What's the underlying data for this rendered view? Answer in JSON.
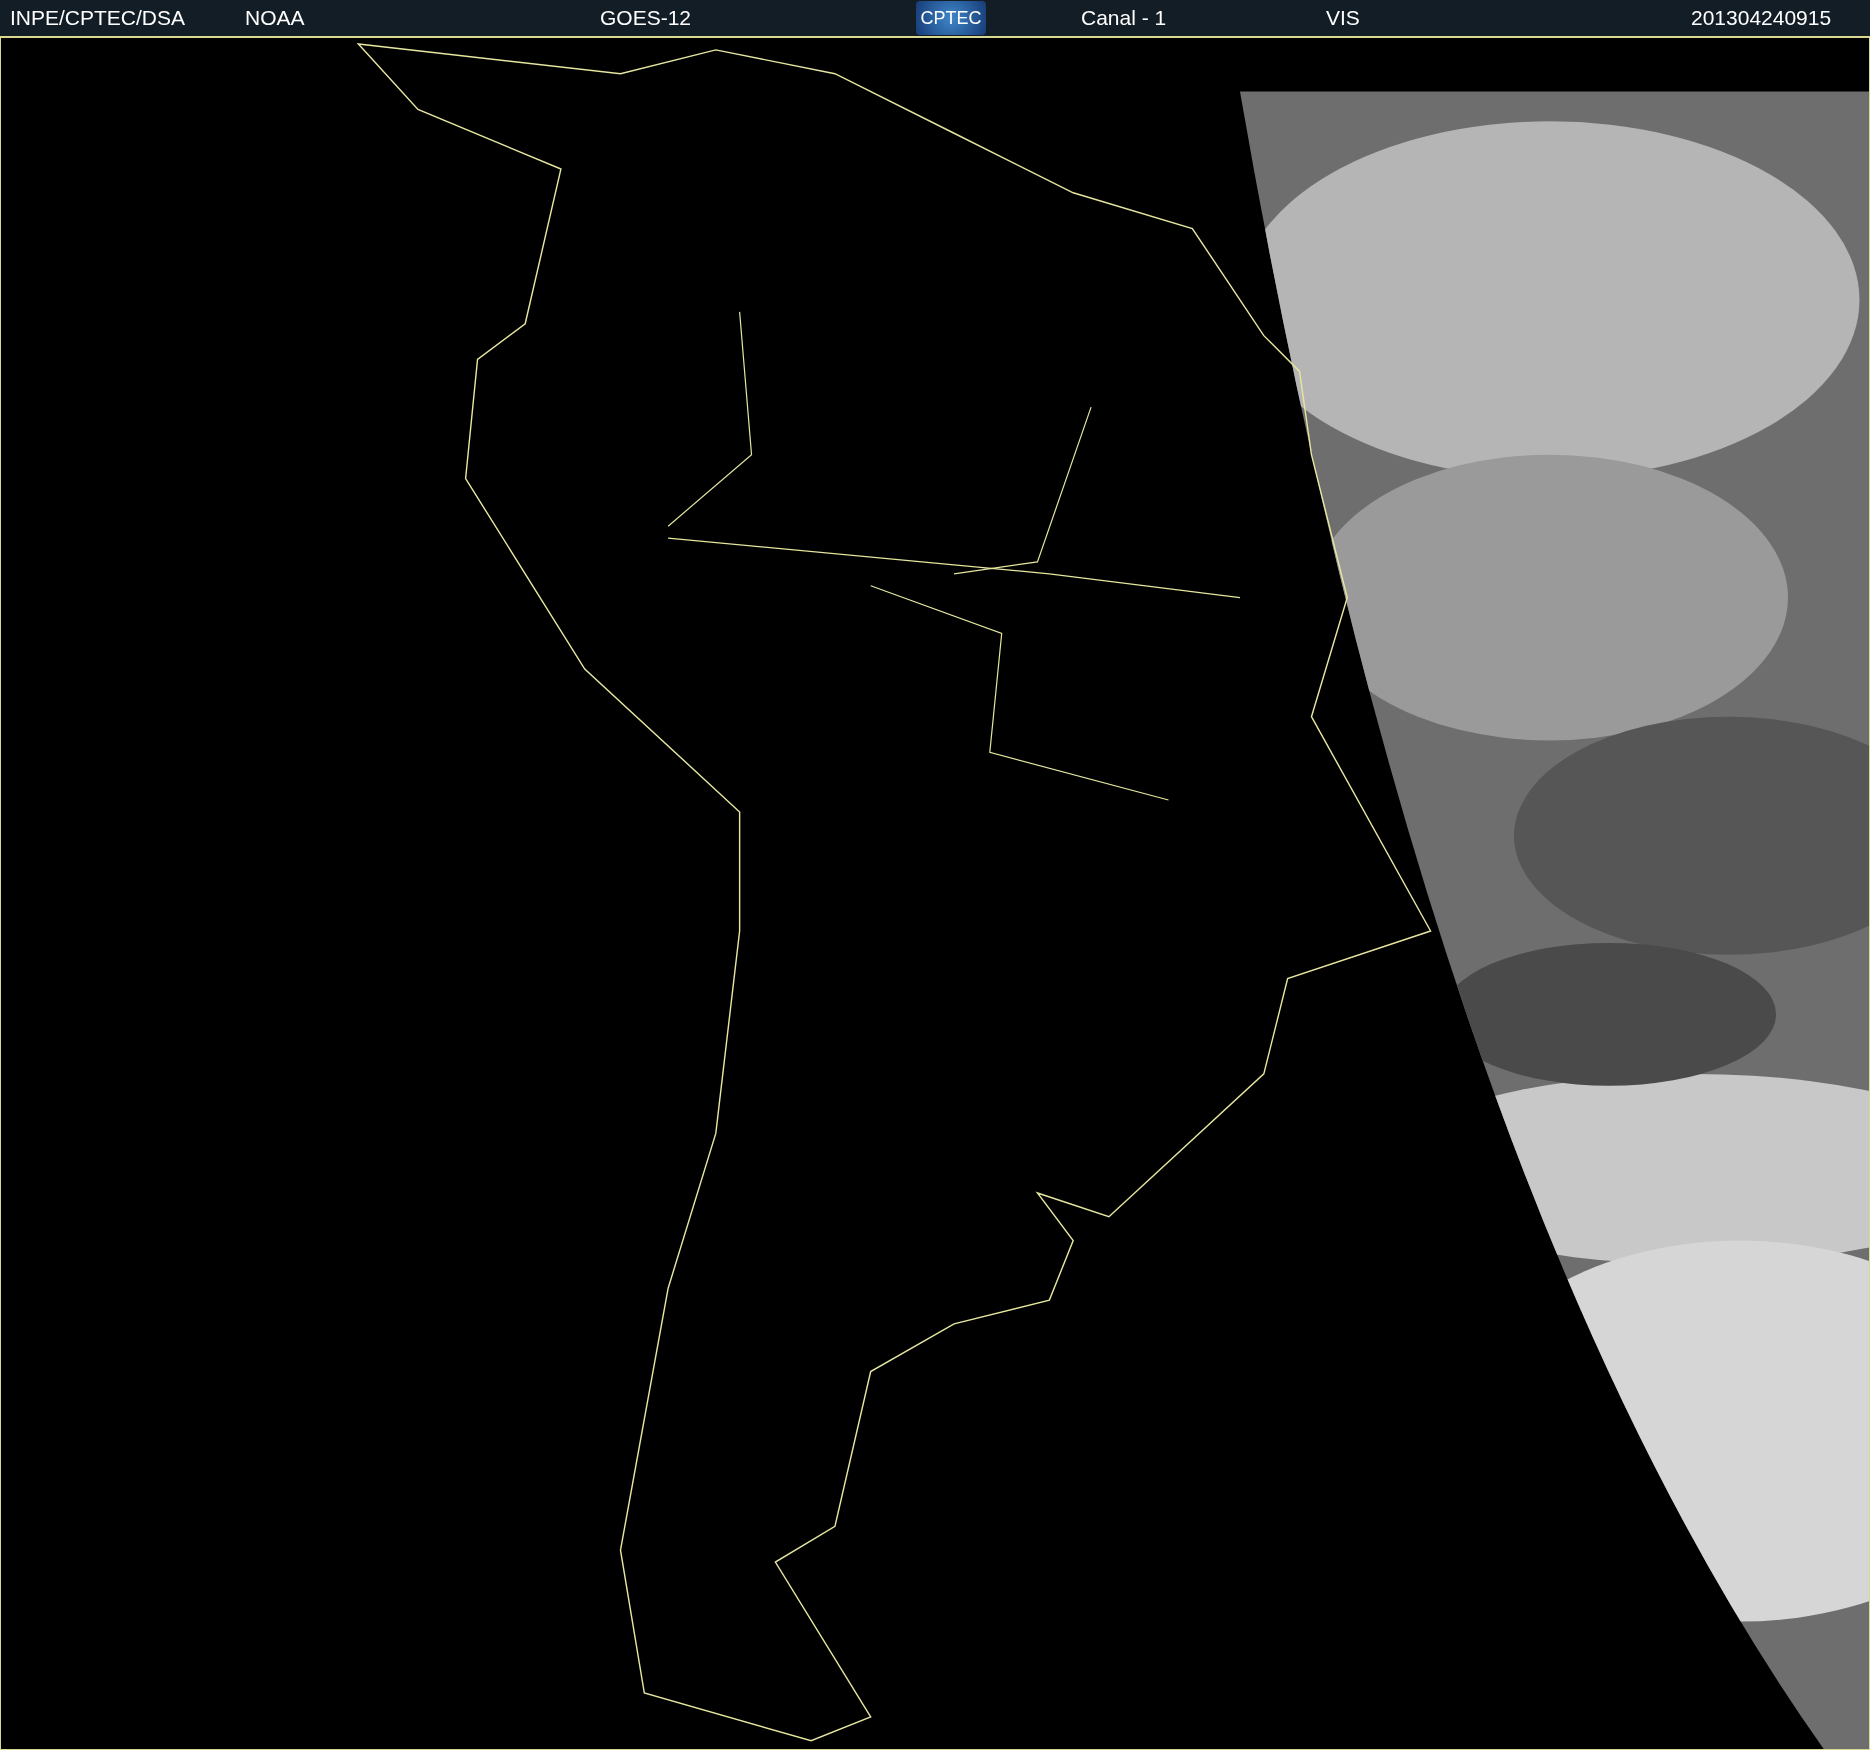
{
  "header": {
    "source": "INPE/CPTEC/DSA",
    "agency": "NOAA",
    "satellite": "GOES-12",
    "logo_text": "CPTEC",
    "channel": "Canal - 1",
    "band": "VIS",
    "timestamp": "201304240915"
  }
}
